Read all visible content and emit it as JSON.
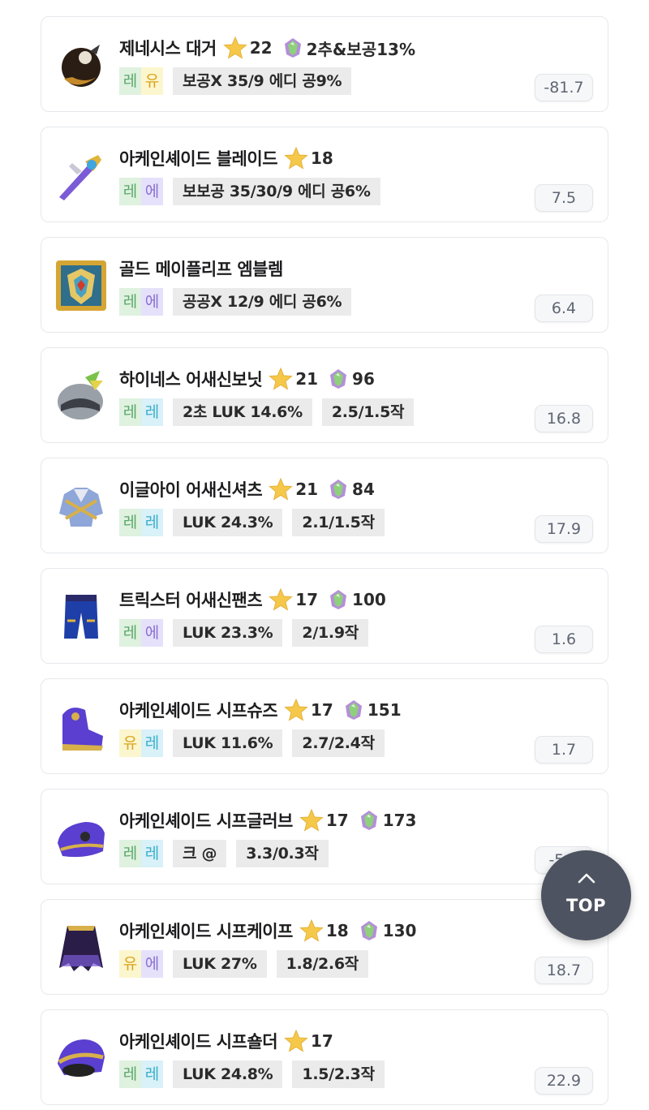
{
  "colors": {
    "legendary_green": "#5aa86a",
    "unique_yellow": "#d9a41a",
    "epic_purple": "#8a6fd1",
    "rare_cyan": "#3aaecc"
  },
  "items": [
    {
      "name": "제네시스 대거",
      "icon": "genesis-dagger-icon",
      "stars": "22",
      "flame": "2추&보공13%",
      "grade": [
        "레",
        "유"
      ],
      "grade_colors": [
        "legendary",
        "unique"
      ],
      "options": [
        "보공X 35/9 에디 공9%"
      ],
      "score": "-81.7"
    },
    {
      "name": "아케인셰이드 블레이드",
      "icon": "arcane-blade-icon",
      "stars": "18",
      "flame": "",
      "grade": [
        "레",
        "에"
      ],
      "grade_colors": [
        "legendary",
        "epic"
      ],
      "options": [
        "보보공 35/30/9 에디 공6%"
      ],
      "score": "7.5"
    },
    {
      "name": "골드 메이플리프 엠블렘",
      "icon": "emblem-icon",
      "stars": "",
      "flame": "",
      "grade": [
        "레",
        "에"
      ],
      "grade_colors": [
        "legendary",
        "epic"
      ],
      "options": [
        "공공X 12/9 에디 공6%"
      ],
      "score": "6.4"
    },
    {
      "name": "하이네스 어새신보닛",
      "icon": "hat-icon",
      "stars": "21",
      "flame": "96",
      "grade": [
        "레",
        "레"
      ],
      "grade_colors": [
        "legendary",
        "rare"
      ],
      "options": [
        "2초 LUK 14.6%",
        "2.5/1.5작"
      ],
      "score": "16.8"
    },
    {
      "name": "이글아이 어새신셔츠",
      "icon": "shirt-icon",
      "stars": "21",
      "flame": "84",
      "grade": [
        "레",
        "레"
      ],
      "grade_colors": [
        "legendary",
        "rare"
      ],
      "options": [
        "LUK 24.3%",
        "2.1/1.5작"
      ],
      "score": "17.9"
    },
    {
      "name": "트릭스터 어새신팬츠",
      "icon": "pants-icon",
      "stars": "17",
      "flame": "100",
      "grade": [
        "레",
        "에"
      ],
      "grade_colors": [
        "legendary",
        "epic"
      ],
      "options": [
        "LUK 23.3%",
        "2/1.9작"
      ],
      "score": "1.6"
    },
    {
      "name": "아케인셰이드 시프슈즈",
      "icon": "shoes-icon",
      "stars": "17",
      "flame": "151",
      "grade": [
        "유",
        "레"
      ],
      "grade_colors": [
        "unique",
        "rare"
      ],
      "options": [
        "LUK 11.6%",
        "2.7/2.4작"
      ],
      "score": "1.7"
    },
    {
      "name": "아케인셰이드 시프글러브",
      "icon": "gloves-icon",
      "stars": "17",
      "flame": "173",
      "grade": [
        "레",
        "레"
      ],
      "grade_colors": [
        "legendary",
        "rare"
      ],
      "options": [
        "크 @",
        "3.3/0.3작"
      ],
      "score": "-5.9"
    },
    {
      "name": "아케인셰이드 시프케이프",
      "icon": "cape-icon",
      "stars": "18",
      "flame": "130",
      "grade": [
        "유",
        "에"
      ],
      "grade_colors": [
        "unique",
        "epic"
      ],
      "options": [
        "LUK 27%",
        "1.8/2.6작"
      ],
      "score": "18.7"
    },
    {
      "name": "아케인셰이드 시프숄더",
      "icon": "shoulder-icon",
      "stars": "17",
      "flame": "",
      "grade": [
        "레",
        "레"
      ],
      "grade_colors": [
        "legendary",
        "rare"
      ],
      "options": [
        "LUK 24.8%",
        "1.5/2.3작"
      ],
      "score": "22.9"
    }
  ],
  "top_button": {
    "label": "TOP",
    "icon": "chevron-up-icon"
  }
}
